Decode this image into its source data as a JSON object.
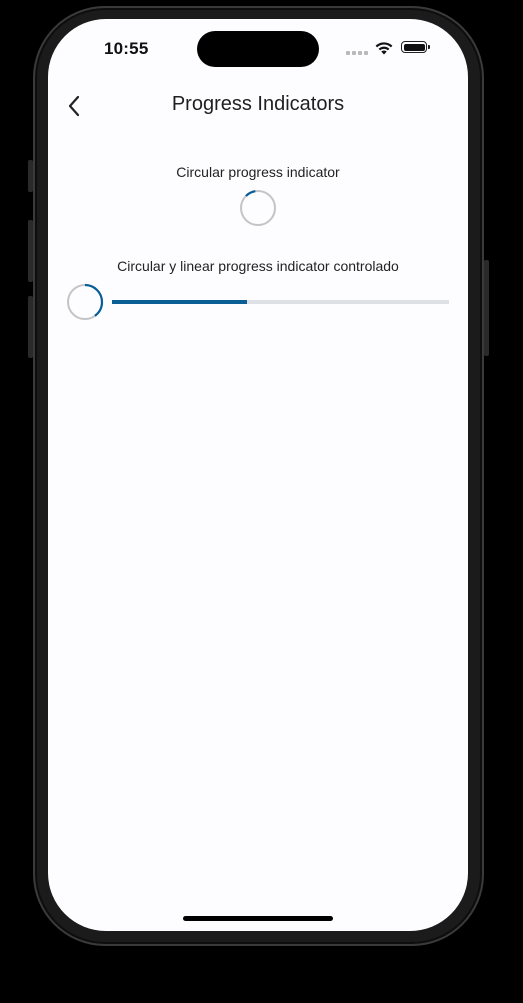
{
  "status_bar": {
    "time": "10:55"
  },
  "nav": {
    "title": "Progress Indicators"
  },
  "sections": {
    "circular_label": "Circular progress indicator",
    "controlled_label": "Circular y linear progress indicator controlado"
  },
  "progress": {
    "circular_indeterminate_fraction": 0.1,
    "controlled_circular_fraction": 0.4,
    "controlled_linear_fraction": 0.4
  },
  "colors": {
    "accent": "#0a5e96",
    "track": "#dde1e5",
    "ring": "#c4c4c4"
  }
}
